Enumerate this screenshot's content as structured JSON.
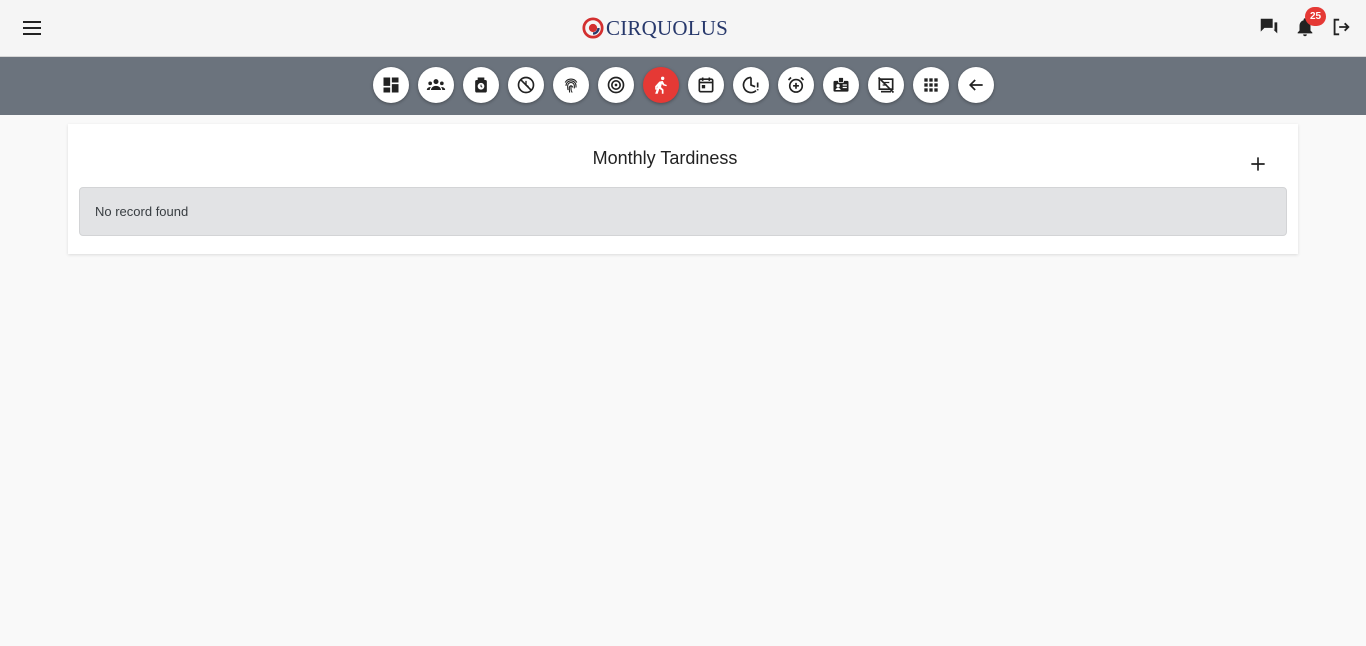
{
  "header": {
    "brand": "CIRQUOLUS",
    "notification_count": "25",
    "icons": [
      "menu-icon",
      "chat-icon",
      "bell-icon",
      "logout-icon"
    ]
  },
  "toolbar": {
    "items": [
      {
        "name": "dashboard-icon",
        "active": false
      },
      {
        "name": "team-icon",
        "active": false
      },
      {
        "name": "punch-clock-icon",
        "active": false
      },
      {
        "name": "no-attendance-icon",
        "active": false
      },
      {
        "name": "fingerprint-icon",
        "active": false
      },
      {
        "name": "target-icon",
        "active": false
      },
      {
        "name": "running-late-icon",
        "active": true
      },
      {
        "name": "calendar-icon",
        "active": false
      },
      {
        "name": "overtime-icon",
        "active": false
      },
      {
        "name": "add-alarm-icon",
        "active": false
      },
      {
        "name": "id-card-icon",
        "active": false
      },
      {
        "name": "desk-icon",
        "active": false
      },
      {
        "name": "apps-grid-icon",
        "active": false
      },
      {
        "name": "back-arrow-icon",
        "active": false
      }
    ],
    "active_color": "#e53935"
  },
  "main": {
    "title": "Monthly Tardiness",
    "empty_message": "No record found"
  }
}
